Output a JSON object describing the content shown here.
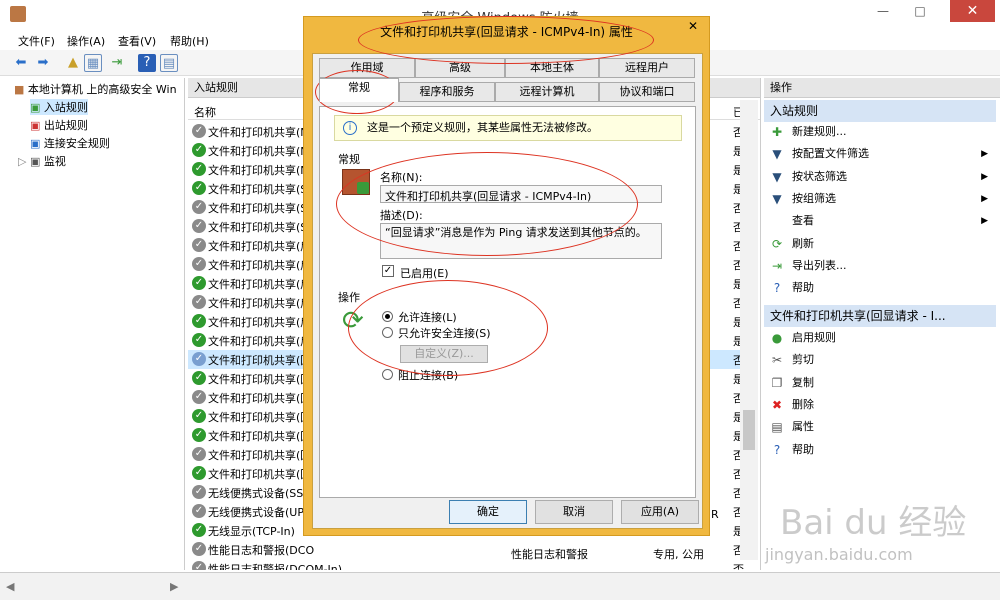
{
  "window": {
    "title": "高级安全 Windows 防火墙"
  },
  "menu": [
    "文件(F)",
    "操作(A)",
    "查看(V)",
    "帮助(H)"
  ],
  "tree": {
    "root": "本地计算机 上的高级安全 Win",
    "items": [
      "入站规则",
      "出站规则",
      "连接安全规则",
      "监视"
    ]
  },
  "list": {
    "title": "入站规则",
    "col_name": "名称",
    "col_enabled": "已",
    "rows": [
      {
        "name": "文件和打印机共享(N",
        "enabled": "否",
        "status": "grey"
      },
      {
        "name": "文件和打印机共享(N",
        "enabled": "是",
        "status": "green"
      },
      {
        "name": "文件和打印机共享(N",
        "enabled": "是",
        "status": "green"
      },
      {
        "name": "文件和打印机共享(S",
        "enabled": "是",
        "status": "green"
      },
      {
        "name": "文件和打印机共享(S",
        "enabled": "否",
        "status": "grey"
      },
      {
        "name": "文件和打印机共享(S",
        "enabled": "否",
        "status": "grey"
      },
      {
        "name": "文件和打印机共享(后",
        "enabled": "否",
        "status": "grey"
      },
      {
        "name": "文件和打印机共享(后",
        "enabled": "否",
        "status": "grey"
      },
      {
        "name": "文件和打印机共享(后",
        "enabled": "是",
        "status": "green"
      },
      {
        "name": "文件和打印机共享(后",
        "enabled": "否",
        "status": "grey"
      },
      {
        "name": "文件和打印机共享(后",
        "enabled": "是",
        "status": "green"
      },
      {
        "name": "文件和打印机共享(后",
        "enabled": "是",
        "status": "green"
      },
      {
        "name": "文件和打印机共享(回",
        "enabled": "否",
        "status": "selected"
      },
      {
        "name": "文件和打印机共享(回",
        "enabled": "是",
        "status": "green"
      },
      {
        "name": "文件和打印机共享(回",
        "enabled": "否",
        "status": "grey"
      },
      {
        "name": "文件和打印机共享(回",
        "enabled": "是",
        "status": "green"
      },
      {
        "name": "文件和打印机共享(回",
        "enabled": "是",
        "status": "green"
      },
      {
        "name": "文件和打印机共享(回",
        "enabled": "否",
        "status": "grey"
      },
      {
        "name": "文件和打印机共享(回",
        "enabled": "否",
        "status": "green"
      },
      {
        "name": "无线便携式设备(SSI",
        "enabled": "否",
        "status": "grey"
      },
      {
        "name": "无线便携式设备(UP",
        "enabled": "否",
        "status": "grey"
      },
      {
        "name": "无线显示(TCP-In)",
        "enabled": "是",
        "status": "green"
      },
      {
        "name": "性能日志和警报(DCO",
        "enabled": "否",
        "status": "grey"
      },
      {
        "name": "性能日志和警报(DCOM-In)",
        "enabled": "否",
        "status": "grey"
      }
    ],
    "partial_group": "性能日志和警报",
    "partial_profile": "专用, 公用",
    "partial_r": "R"
  },
  "actions": {
    "header": "操作",
    "section1": "入站规则",
    "items1": [
      {
        "label": "新建规则...",
        "icon": "new-rule-icon",
        "arrow": false
      },
      {
        "label": "按配置文件筛选",
        "icon": "filter-icon",
        "arrow": true
      },
      {
        "label": "按状态筛选",
        "icon": "filter-icon",
        "arrow": true
      },
      {
        "label": "按组筛选",
        "icon": "filter-icon",
        "arrow": true
      },
      {
        "label": "查看",
        "icon": "",
        "arrow": true
      },
      {
        "label": "刷新",
        "icon": "refresh-icon",
        "arrow": false
      },
      {
        "label": "导出列表...",
        "icon": "export-icon",
        "arrow": false
      },
      {
        "label": "帮助",
        "icon": "help-icon",
        "arrow": false
      }
    ],
    "section2": "文件和打印机共享(回显请求 - I...",
    "items2": [
      {
        "label": "启用规则",
        "icon": "enable-icon"
      },
      {
        "label": "剪切",
        "icon": "cut-icon"
      },
      {
        "label": "复制",
        "icon": "copy-icon"
      },
      {
        "label": "删除",
        "icon": "delete-icon"
      },
      {
        "label": "属性",
        "icon": "properties-icon"
      },
      {
        "label": "帮助",
        "icon": "help-icon"
      }
    ]
  },
  "dialog": {
    "title": "文件和打印机共享(回显请求 - ICMPv4-In) 属性",
    "tabs_row1": [
      "作用域",
      "高级",
      "本地主体",
      "远程用户"
    ],
    "tabs_row2": [
      "常规",
      "程序和服务",
      "远程计算机",
      "协议和端口"
    ],
    "info": "这是一个预定义规则，其某些属性无法被修改。",
    "general_label": "常规",
    "name_label": "名称(N):",
    "name_value": "文件和打印机共享(回显请求 - ICMPv4-In)",
    "desc_label": "描述(D):",
    "desc_value": "“回显请求”消息是作为 Ping 请求发送到其他节点的。",
    "enabled_label": "已启用(E)",
    "action_label": "操作",
    "radio_allow": "允许连接(L)",
    "radio_secure": "只允许安全连接(S)",
    "custom_button": "自定义(Z)...",
    "radio_block": "阻止连接(B)",
    "ok": "确定",
    "cancel": "取消",
    "apply": "应用(A)"
  },
  "watermark": {
    "main": "Bai du 经验",
    "sub": "jingyan.baidu.com"
  }
}
